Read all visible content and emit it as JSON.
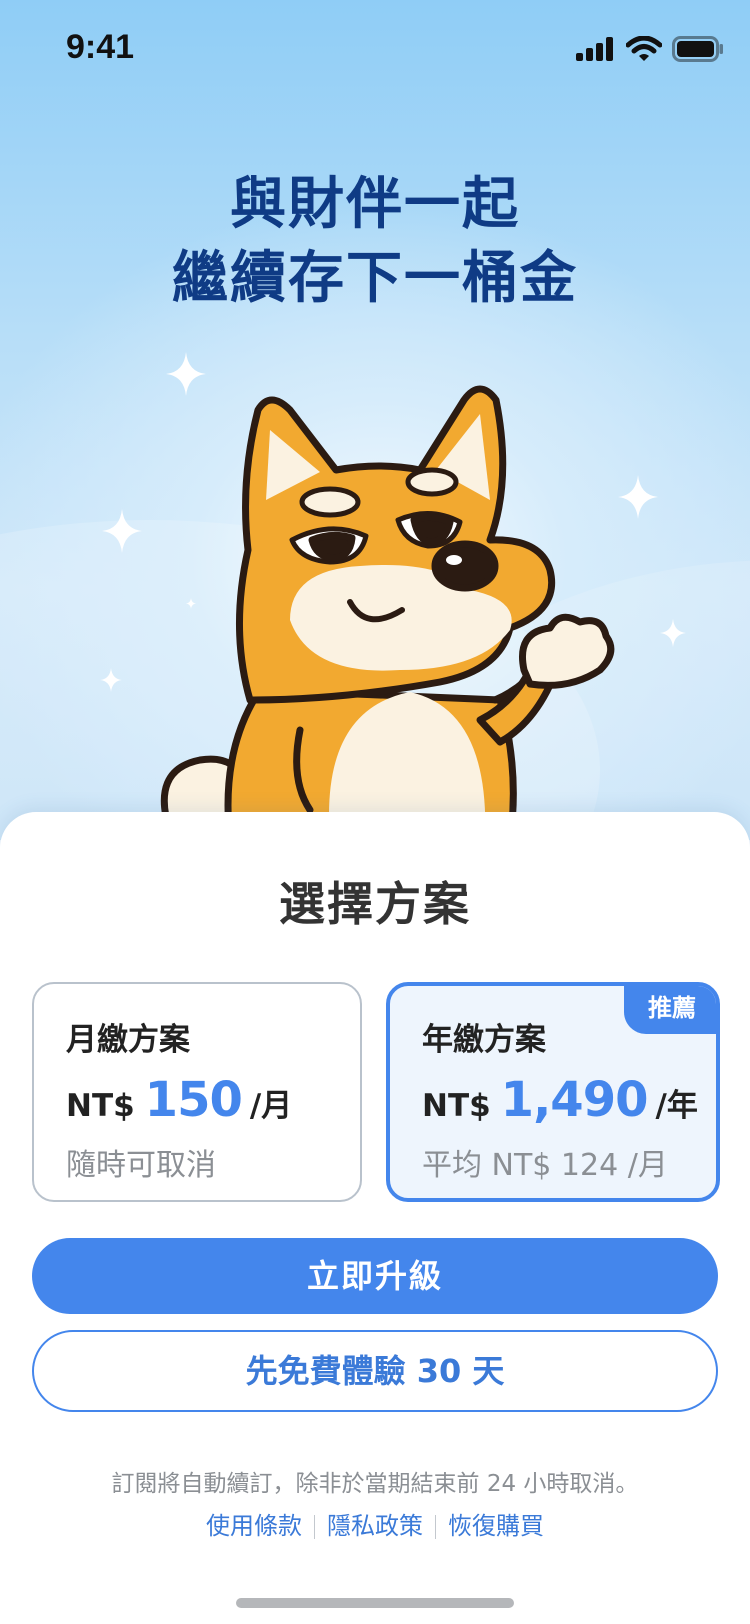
{
  "status_bar": {
    "time": "9:41",
    "icons": [
      "cellular-signal-icon",
      "wifi-icon",
      "battery-icon"
    ]
  },
  "hero": {
    "headline_line1": "與財伴一起",
    "headline_line2": "繼續存下一桶金",
    "mascot": "shiba-dog-mascot"
  },
  "sheet": {
    "title": "選擇方案"
  },
  "plans": [
    {
      "name": "月繳方案",
      "currency": "NT$",
      "amount": "150",
      "period": "/月",
      "note": "隨時可取消",
      "selected": false
    },
    {
      "name": "年繳方案",
      "currency": "NT$",
      "amount": "1,490",
      "period": "/年",
      "note": "平均 NT$ 124 /月",
      "badge": "推薦",
      "selected": true
    }
  ],
  "buttons": {
    "upgrade": "立即升級",
    "trial": "先免費體驗 30 天"
  },
  "footer": {
    "disclaimer": "訂閱將自動續訂，除非於當期結束前 24 小時取消。",
    "links": [
      "使用條款",
      "隱私政策",
      "恢復購買"
    ]
  },
  "colors": {
    "accent": "#4486ec",
    "headline": "#0f3b85",
    "mascot_fur": "#f2a930"
  }
}
